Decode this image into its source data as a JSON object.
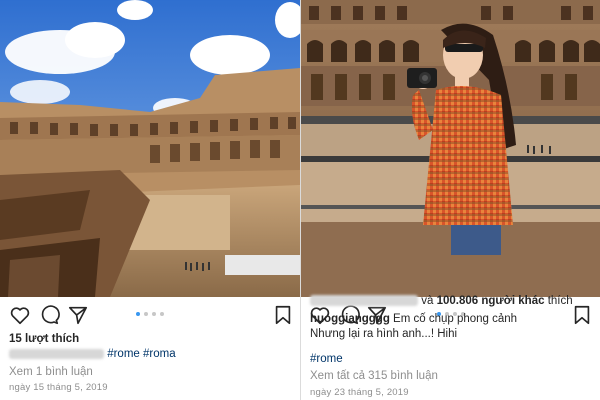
{
  "left_post": {
    "likes": "15 lượt thích",
    "hashtags": "#rome #roma",
    "view_comments": "Xem 1 bình luận",
    "date": "ngày 15 tháng 5, 2019",
    "carousel_count": 4,
    "carousel_active": 1
  },
  "right_post": {
    "liked_by_and": "và",
    "liked_by_others": "100.806 người khác",
    "liked_by_suffix": "thích",
    "username": "huoggiangggg",
    "caption_line1": "Em cố chụp phong cảnh",
    "caption_line2": "Nhưng lại ra hình anh...! Hihi",
    "hashtag": "#rome",
    "view_comments": "Xem tất cả 315 bình luận",
    "date": "ngày 23 tháng 5, 2019",
    "carousel_count": 4,
    "carousel_active": 1
  },
  "icons": [
    "heart-icon",
    "comment-icon",
    "share-icon",
    "bookmark-icon",
    "camera-icon"
  ],
  "colors": {
    "link": "#003569",
    "muted": "#8e8e8e",
    "dot_active": "#3897f0",
    "sky": "#3a7bd5",
    "stone": "#b08a62"
  }
}
